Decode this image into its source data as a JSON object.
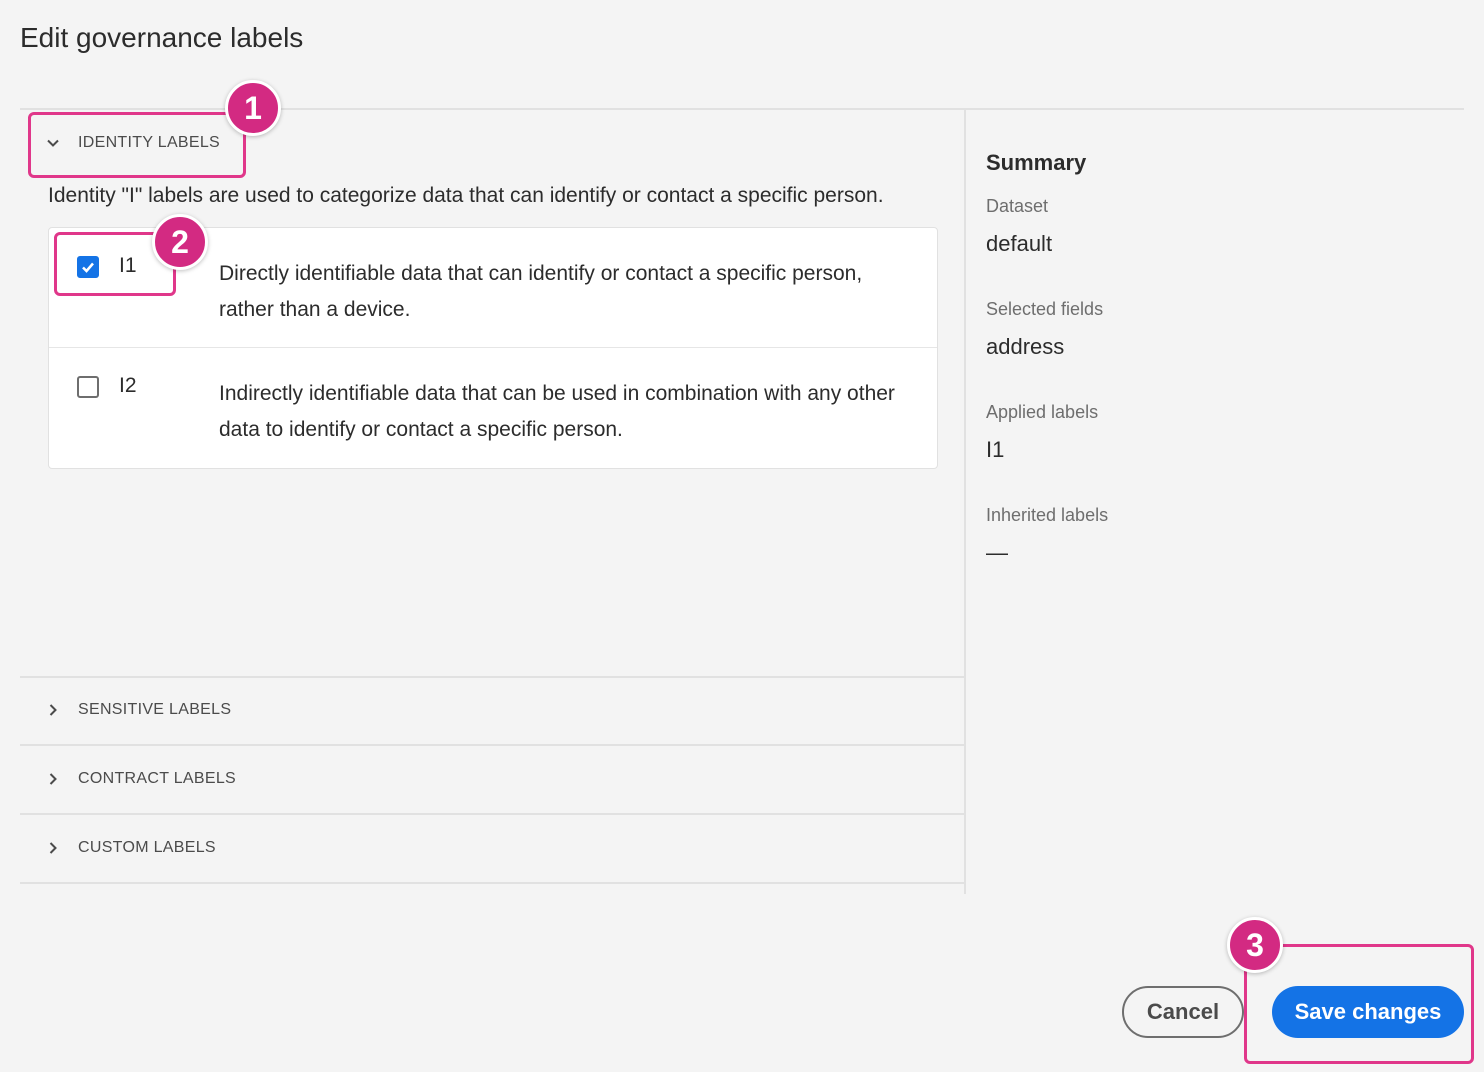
{
  "dialog": {
    "title": "Edit governance labels"
  },
  "sections": {
    "identity": {
      "label": "IDENTITY LABELS",
      "description": "Identity \"I\" labels are used to categorize data that can identify or contact a specific person.",
      "items": [
        {
          "code": "I1",
          "description": "Directly identifiable data that can identify or contact a specific person, rather than a device.",
          "checked": true
        },
        {
          "code": "I2",
          "description": "Indirectly identifiable data that can be used in combination with any other data to identify or contact a specific person.",
          "checked": false
        }
      ]
    },
    "sensitive": {
      "label": "SENSITIVE LABELS"
    },
    "contract": {
      "label": "CONTRACT LABELS"
    },
    "custom": {
      "label": "CUSTOM LABELS"
    }
  },
  "summary": {
    "title": "Summary",
    "dataset_label": "Dataset",
    "dataset_value": "default",
    "selected_fields_label": "Selected fields",
    "selected_fields_value": "address",
    "applied_labels_label": "Applied labels",
    "applied_labels_value": "I1",
    "inherited_labels_label": "Inherited labels",
    "inherited_labels_value": "—"
  },
  "buttons": {
    "cancel": "Cancel",
    "save": "Save changes"
  },
  "callouts": [
    "1",
    "2",
    "3"
  ],
  "colors": {
    "accent": "#1473e6",
    "callout": "#d32a82"
  },
  "icons": {
    "identity_chevron": "chevron-down-icon",
    "collapsed_chevron": "chevron-right-icon",
    "checkbox_checked": "checkmark-icon"
  }
}
